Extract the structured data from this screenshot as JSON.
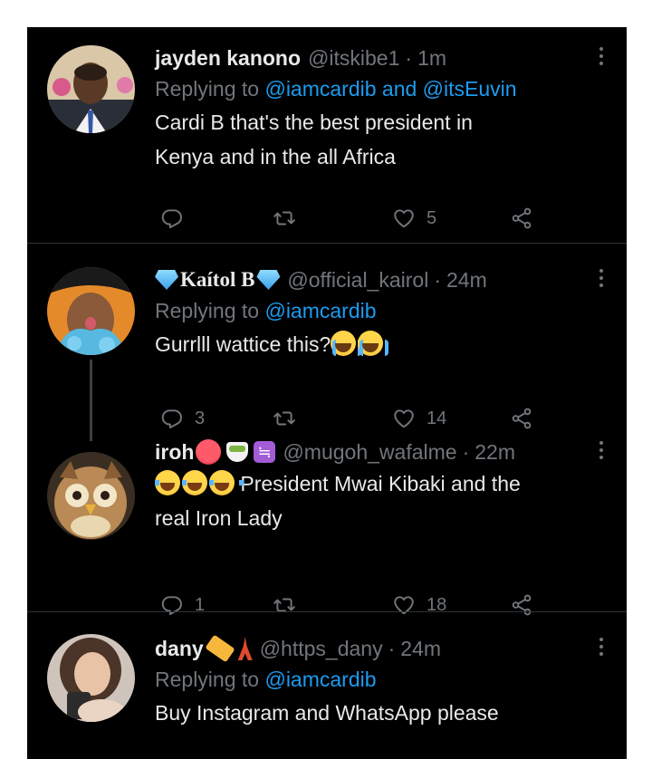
{
  "colors": {
    "background": "#000000",
    "text": "#e7e9ea",
    "muted": "#71767b",
    "link": "#1d9bf0",
    "divider": "#2f3336"
  },
  "tweets": [
    {
      "name": "jayden kanono",
      "handle": "@itskibe1",
      "time": "1m",
      "reply_prefix": "Replying to",
      "reply_mentions": "@iamcardib and @itsEuvin",
      "text_lines": [
        "Cardi B that's the best president in",
        "Kenya and in the all Africa"
      ],
      "replies": "",
      "retweets": "",
      "likes": "5"
    },
    {
      "name": "Kaítol B",
      "handle": "@official_kairol",
      "time": "24m",
      "reply_prefix": "Replying to",
      "reply_mentions": "@iamcardib",
      "text": "Gurrlll wattice this?",
      "replies": "3",
      "retweets": "",
      "likes": "14"
    },
    {
      "name": "iroh",
      "handle": "@mugoh_wafalme",
      "time": "22m",
      "text_line1": "President Mwai Kibaki and the",
      "text_line2": "real Iron Lady",
      "replies": "1",
      "retweets": "",
      "likes": "18"
    },
    {
      "name": "dany",
      "handle": "@https_dany",
      "time": "24m",
      "reply_prefix": "Replying to",
      "reply_mentions": "@iamcardib",
      "text": "Buy Instagram and WhatsApp please"
    }
  ],
  "separator": "·",
  "icons": [
    "reply-icon",
    "retweet-icon",
    "like-icon",
    "share-icon",
    "more-icon"
  ]
}
